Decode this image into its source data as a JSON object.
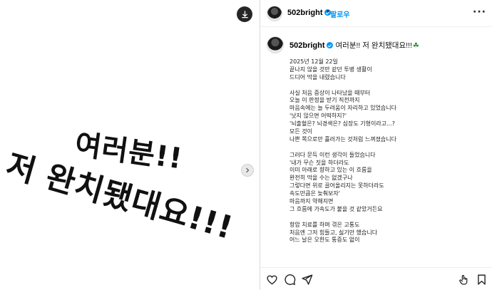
{
  "media": {
    "text_line1": "여러분!!",
    "text_line2": "저 완치됐대요!!!"
  },
  "header": {
    "username": "502bright",
    "separator": "•",
    "follow_label": "팔로우",
    "more_label": "···"
  },
  "caption": {
    "username": "502bright",
    "title": "여러분!! 저 완치됐대요!!!",
    "clover": "☘",
    "lines": [
      "2025년 12월 22일",
      "끝나지 않을 것만 같던 투병 생활이",
      "드디어 막을 내렸습니다",
      "",
      "사실 처음 증상이 나타났을 때부터",
      "오늘 이 판정을 받기 직전까지",
      "마음속에는 늘 두려움이 자리하고 있었습니다",
      "'낫지 않으면 어떡하지?'",
      "'뇌출혈은? 뇌경색은? 심장도 기형이라고...?",
      "모든 것이",
      "나쁜 쪽으로만 흘러가는 것처럼 느껴졌습니다",
      "",
      "그러다 문득 이런 생각이 들었습니다",
      "'내가 무슨 짓을 하더라도",
      "이미 아래로 향하고 있는 이 흐름을",
      "완전히 막을 수는 없겠구나",
      "그렇다면 위로 끌어올리지는 못하더라도",
      "속도만큼은 늦춰보자'",
      "마음까지 약해지면",
      "그 흐름에 가속도가 붙을 것 같았거든요",
      "",
      "항암 치료를 하며 겪은 고통도",
      "처음엔 그저 힘들고, 싫기만 했습니다",
      "어느 날은 오한도 통증도 없이"
    ]
  },
  "colors": {
    "accent": "#0095f6",
    "text": "#222222",
    "border": "#dbdbdb"
  },
  "icons": {
    "save_media": "download-icon",
    "next": "chevron-right-icon",
    "like": "heart-icon",
    "comment": "comment-icon",
    "share": "paper-plane-icon",
    "react": "hand-pointer-icon",
    "bookmark": "bookmark-icon"
  }
}
